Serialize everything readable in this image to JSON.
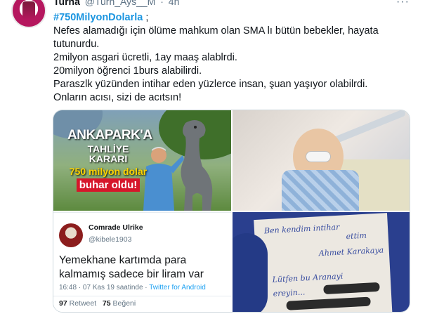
{
  "tweet": {
    "author_name": "Turna",
    "author_handle": "@Turn_Ays__M",
    "separator": "·",
    "age": "4h",
    "more_label": "···",
    "hashtag": "#750MilyonDolarla",
    "hashtag_suffix": " ;",
    "lines": [
      "Nefes alamadığı için ölüme mahkum olan SMA lı bütün bebekler, hayata",
      "tutunurdu.",
      "2milyon asgari ücretli, 1ay  maaş alablrdi.",
      "20milyon öğrenci 1burs alabilirdi.",
      "Paraszlk yüzünden intihar eden yüzlerce insan, şuan yaşıyor olabilrdi.",
      "Onların acısı, sizi de acıtsın!"
    ]
  },
  "media": {
    "image1": {
      "caption_line1": "ANKAPARK'A",
      "caption_line2": "TAHLİYE KARARI",
      "caption_line3": "750 milyon dolar",
      "caption_line4": "buhar oldu!"
    },
    "image2": {
      "name": "Comrade Ulrike",
      "handle": "@kibele1903",
      "body": "Yemekhane kartımda para kalmamış sadece bir liram var",
      "time": "16:48 · 07 Kas 19 saatinde · ",
      "source": "Twitter for Android",
      "retweet_count": "97",
      "retweet_label": "Retweet",
      "like_count": "75",
      "like_label": "Beğeni"
    },
    "image4": {
      "note_line1": "Ben kendim intihar",
      "note_line2": "ettim",
      "note_line3": "Ahmet Karakaya",
      "note_line4": "Lütfen bu Aranayi",
      "note_line5": "ereyin..."
    }
  },
  "colors": {
    "link": "#1b95e0",
    "text": "#0f1419",
    "secondary": "#5b7083",
    "border": "#cfd9de"
  }
}
